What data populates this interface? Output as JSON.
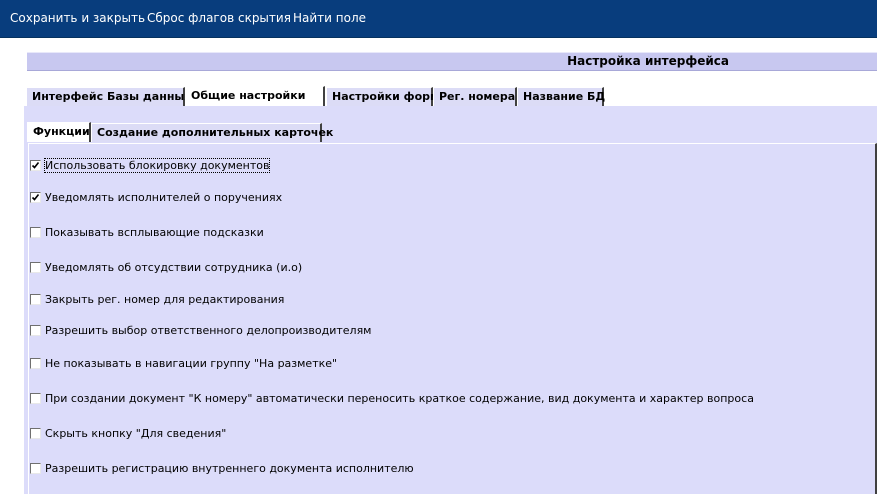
{
  "menu": {
    "save_close": "Сохранить и закрыть",
    "reset_flags": "Сброс флагов скрытия",
    "find_field": "Найти поле"
  },
  "title": "Настройка интерфейса",
  "tabs": [
    {
      "label": "Интерфейс Базы данных",
      "active": false
    },
    {
      "label": "Общие настройки",
      "active": true
    },
    {
      "label": "Настройки форм",
      "active": false
    },
    {
      "label": "Рег. номера",
      "active": false
    },
    {
      "label": "Название БД",
      "active": false
    }
  ],
  "subtabs": [
    {
      "label": "Функции",
      "active": true
    },
    {
      "label": "Создание дополнительных карточек",
      "active": false
    }
  ],
  "options": [
    {
      "label": "Использовать блокировку документов",
      "checked": true
    },
    {
      "label": "Уведомлять исполнителей о поручениях",
      "checked": true
    },
    {
      "label": "Показывать всплывающие подсказки",
      "checked": false
    },
    {
      "label": "Уведомлять об отсудствии сотрудника (и.о)",
      "checked": false
    },
    {
      "label": "Закрыть рег. номер для редактирования",
      "checked": false
    },
    {
      "label": "Разрешить выбор ответственного делопроизводителям",
      "checked": false
    },
    {
      "label": "Не показывать в навигации группу \"На разметке\"",
      "checked": false
    },
    {
      "label": "При создании документ \"К номеру\" автоматически переносить краткое содержание, вид документа и характер вопроса",
      "checked": false
    },
    {
      "label": "Скрыть кнопку \"Для сведения\"",
      "checked": false
    },
    {
      "label": "Разрешить регистрацию внутреннего документа исполнителю",
      "checked": false
    }
  ]
}
